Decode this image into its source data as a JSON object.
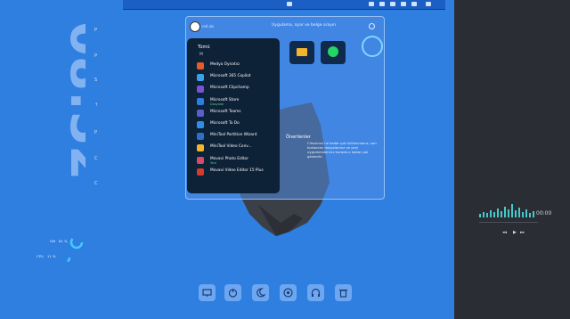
{
  "clock": {
    "time": "08:52",
    "vertical_letters": [
      "P",
      "P",
      "S",
      "↑",
      "P",
      "C",
      "C",
      "↑"
    ]
  },
  "window": {
    "user_name": "ced ais",
    "search_placeholder": "Uygulama, ayar ve belge arayın"
  },
  "start_menu": {
    "header": "Tümü",
    "letter": "M",
    "items": [
      {
        "label": "Medya Oynatıcı",
        "sub": "",
        "icon": "media-player-icon",
        "color": "#e85a2c"
      },
      {
        "label": "Microsoft 365 Copilot",
        "sub": "",
        "icon": "copilot-icon",
        "color": "#3aa0e8"
      },
      {
        "label": "Microsoft Clipchamp",
        "sub": "",
        "icon": "clipchamp-icon",
        "color": "#7b52d6"
      },
      {
        "label": "Microsoft Store",
        "sub": "Dosyalar",
        "icon": "store-icon",
        "color": "#2f7de0"
      },
      {
        "label": "Microsoft Teams",
        "sub": "",
        "icon": "teams-icon",
        "color": "#5b5fc7"
      },
      {
        "label": "Microsoft To Do",
        "sub": "",
        "icon": "todo-icon",
        "color": "#2f8fe8"
      },
      {
        "label": "MiniTool Partition Wizard",
        "sub": "",
        "icon": "partition-icon",
        "color": "#2d6fd0"
      },
      {
        "label": "MiniTool Video Conv...",
        "sub": "",
        "icon": "folder-icon",
        "color": "#f2b52b"
      },
      {
        "label": "Movavi Photo Editor",
        "sub": "Yeni",
        "icon": "photo-editor-icon",
        "color": "#d64a6e"
      },
      {
        "label": "Movavi Video Editor 15 Plus",
        "sub": "",
        "icon": "video-editor-icon",
        "color": "#d63a2a"
      }
    ]
  },
  "recommendations": {
    "title": "Önerilenler",
    "text": "Cihazınızı ne kadar çok kullanırsanız, son kullanılan dosyalarınız ve yeni uygulamalarınız burada o kadar çok gösterilir."
  },
  "gauges": [
    {
      "label": "GM",
      "value": "61 %"
    },
    {
      "label": "CPU",
      "value": "11 %"
    }
  ],
  "audio": {
    "time": "00:00"
  },
  "dock": [
    "monitor-icon",
    "power-icon",
    "moon-icon",
    "chrome-icon",
    "headphones-icon",
    "trash-icon"
  ]
}
